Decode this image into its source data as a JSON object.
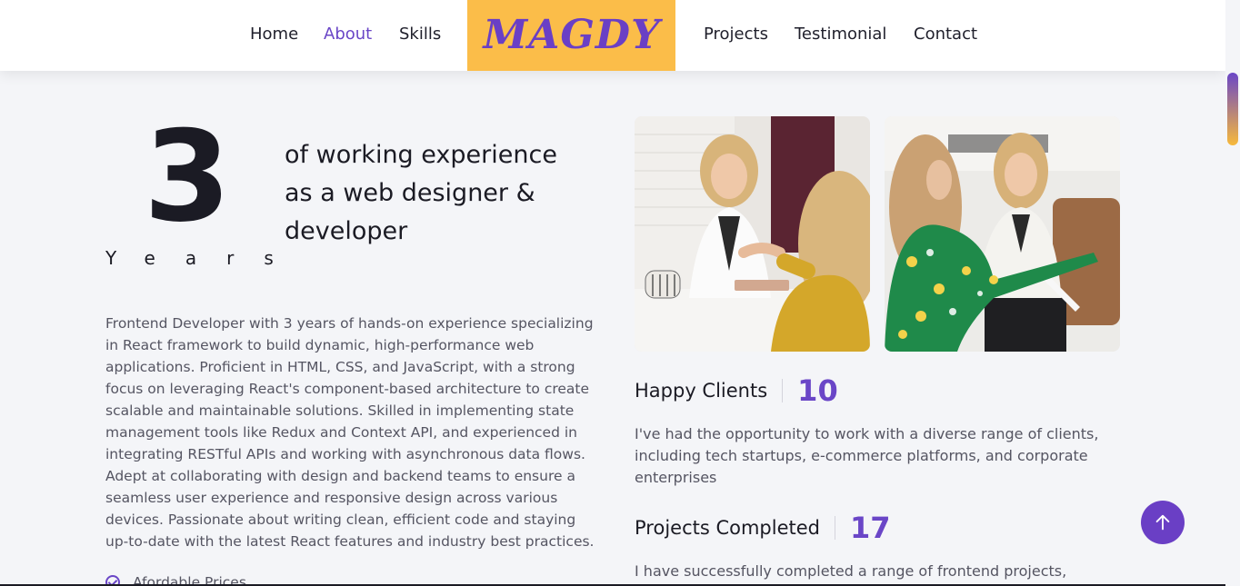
{
  "nav": {
    "left": [
      {
        "label": "Home",
        "active": false
      },
      {
        "label": "About",
        "active": true
      },
      {
        "label": "Skills",
        "active": false
      }
    ],
    "right": [
      {
        "label": "Projects",
        "active": false
      },
      {
        "label": "Testimonial",
        "active": false
      },
      {
        "label": "Contact",
        "active": false
      }
    ],
    "logo_text": "MAGDY",
    "active_color": "#6a46c7",
    "logo_bg": "#fbbd49"
  },
  "experience": {
    "number": "3",
    "unit": "Years",
    "text": "of working experience as a web designer & developer"
  },
  "bio": "Frontend Developer with 3 years of hands-on experience specializing in React framework to build dynamic, high-performance web applications. Proficient in HTML, CSS, and JavaScript, with a strong focus on leveraging React's component-based architecture to create scalable and maintainable solutions. Skilled in implementing state management tools like Redux and Context API, and experienced in integrating RESTful APIs and working with asynchronous data flows. Adept at collaborating with design and backend teams to ensure a seamless user experience and responsive design across various devices. Passionate about writing clean, efficient code and staying up-to-date with the latest React features and industry best practices.",
  "features": [
    {
      "label": "Afordable Prices",
      "icon": "check-circle-icon"
    }
  ],
  "stats": [
    {
      "label": "Happy Clients",
      "value": "10",
      "description": "I've had the opportunity to work with a diverse range of clients, including tech startups, e-commerce platforms, and corporate enterprises"
    },
    {
      "label": "Projects Completed",
      "value": "17",
      "description": "I have successfully completed a range of frontend projects, primarily"
    }
  ],
  "scroll_top": {
    "icon": "arrow-up-icon",
    "color": "#6a3fc5"
  }
}
